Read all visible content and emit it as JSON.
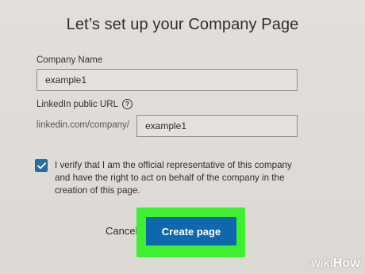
{
  "header": {
    "title": "Let’s set up your Company Page"
  },
  "form": {
    "company_name_label": "Company Name",
    "company_name_value": "example1",
    "url_label": "LinkedIn public URL",
    "url_help_glyph": "?",
    "url_prefix": "linkedin.com/company/",
    "url_value": "example1",
    "verify_checked": true,
    "verify_text": "I verify that I am the official representative of this company and have the right to act on behalf of the company in the creation of this page."
  },
  "actions": {
    "cancel_label": "Cancel",
    "create_label": "Create page"
  },
  "watermark": {
    "wiki": "wiki",
    "how": "How"
  },
  "colors": {
    "primary_button": "#0f68ad",
    "highlight": "#3ef02f",
    "checkbox": "#2a6da3",
    "background": "#dfdcd7"
  }
}
